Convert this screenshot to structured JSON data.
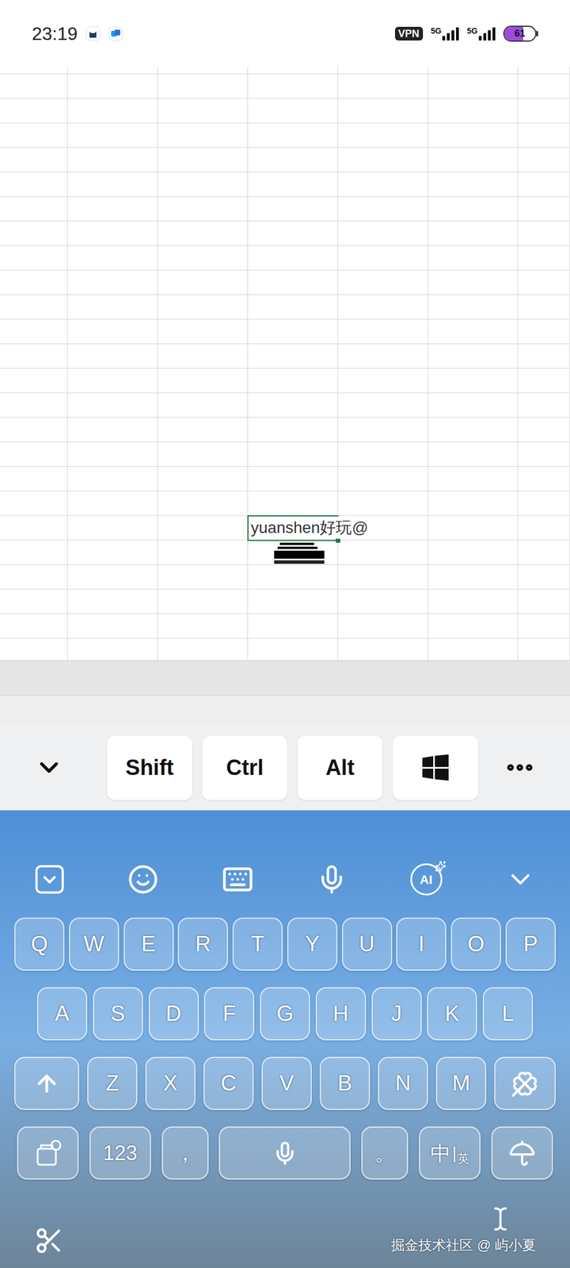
{
  "status_bar": {
    "time": "23:19",
    "vpn": "VPN",
    "signals": [
      {
        "label": "5G",
        "level": 1
      },
      {
        "label": "5G",
        "level": 1
      }
    ],
    "battery": {
      "reading": "61",
      "level": 0.61
    }
  },
  "sheet": {
    "active_cell": {
      "text": "yuanshen好玩@",
      "editing": true
    }
  },
  "toolbar": {
    "keys": [
      "Shift",
      "Ctrl",
      "Alt"
    ]
  },
  "keyboard": {
    "ai_label": "AI",
    "rows": [
      [
        "Q",
        "W",
        "E",
        "R",
        "T",
        "Y",
        "U",
        "I",
        "O",
        "P"
      ],
      [
        "A",
        "S",
        "D",
        "F",
        "G",
        "H",
        "J",
        "K",
        "L"
      ],
      [
        "Z",
        "X",
        "C",
        "V",
        "B",
        "N",
        "M"
      ]
    ],
    "numbers_key": "123",
    "comma_key": "，",
    "period_key": "。",
    "language_key": {
      "main": "中",
      "sub": "英"
    }
  },
  "watermark": "掘金技术社区 @ 屿小夏"
}
